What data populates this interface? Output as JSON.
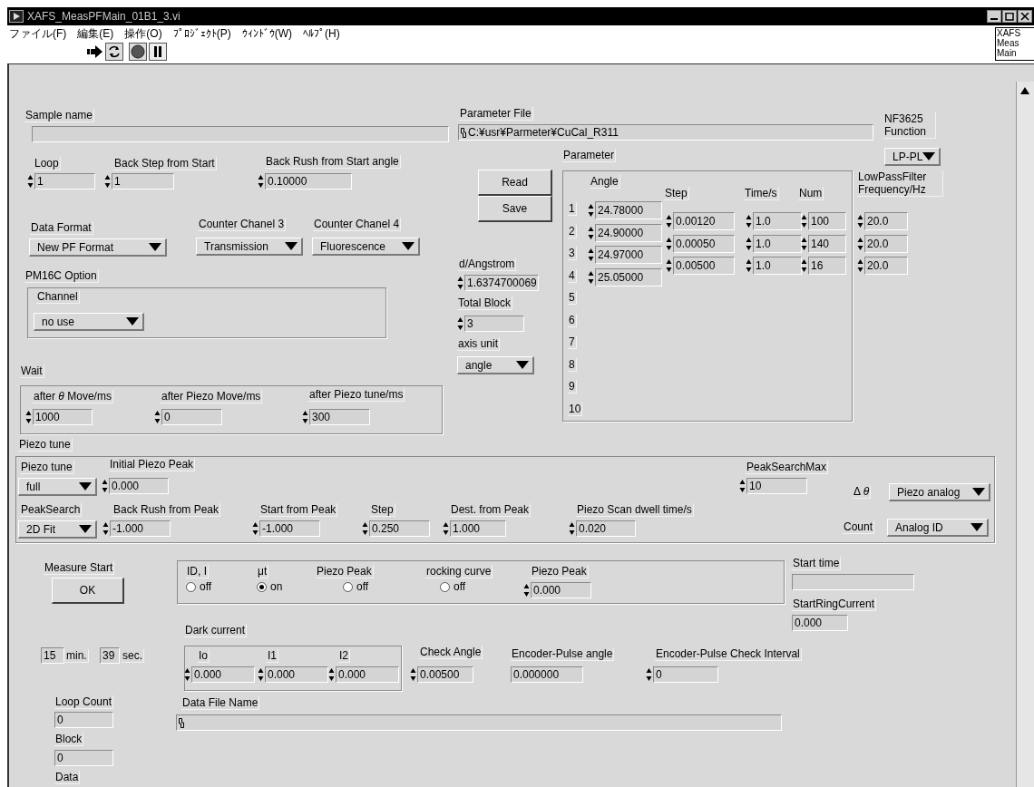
{
  "window": {
    "title": "XAFS_MeasPFMain_01B1_3.vi"
  },
  "menu": [
    "ファイル(F)",
    "編集(E)",
    "操作(O)",
    "ﾌﾟﾛｼﾞｪｸﾄ(P)",
    "ｳｨﾝﾄﾞｳ(W)",
    "ﾍﾙﾌﾟ(H)"
  ],
  "vi_icon": [
    "XAFS",
    "Meas",
    "Main"
  ],
  "items": [
    {
      "kind": "string",
      "label": "Sample name"
    },
    {
      "kind": "numeric",
      "label": "Loop",
      "value": "1"
    },
    {
      "kind": "numeric",
      "label": "Back Step from Start",
      "value": "1"
    },
    {
      "kind": "numeric",
      "label": "Back Rush from Start angle",
      "value": "0.10000"
    },
    {
      "kind": "path",
      "label": "Parameter File",
      "value": "C:¥usr¥Parmeter¥CuCal_R311"
    },
    {
      "kind": "ring",
      "label": "NF3625 Function",
      "value": "LP-PL"
    },
    {
      "kind": "button",
      "value": "Read"
    },
    {
      "kind": "button",
      "value": "Save"
    },
    {
      "kind": "ring",
      "label": "Data Format",
      "value": "New PF Format"
    },
    {
      "kind": "ring",
      "label": "Counter Chanel 3",
      "value": "Transmission"
    },
    {
      "kind": "ring",
      "label": "Counter Chanel 4",
      "value": "Fluorescence"
    },
    {
      "kind": "numeric",
      "label": "d/Angstrom",
      "value": "1.6374700069"
    },
    {
      "kind": "numeric",
      "label": "Total Block",
      "value": "3"
    },
    {
      "kind": "ring",
      "label": "axis unit",
      "value": "angle"
    },
    {
      "kind": "label",
      "label": "PM16C Option"
    },
    {
      "kind": "ring",
      "label": "Channel",
      "value": "no use"
    },
    {
      "kind": "label",
      "label": "Wait"
    },
    {
      "kind": "numeric",
      "label": "after *θ* Move/ms",
      "value": "1000"
    },
    {
      "kind": "numeric",
      "label": "after Piezo Move/ms",
      "value": "0"
    },
    {
      "kind": "numeric",
      "label": "after Piezo tune/ms",
      "value": "300"
    },
    {
      "kind": "label",
      "label": "Piezo tune"
    },
    {
      "kind": "ring",
      "label": "Piezo tune",
      "value": "full"
    },
    {
      "kind": "numeric",
      "label": "Initial Piezo Peak",
      "value": "0.000"
    },
    {
      "kind": "numeric",
      "label": "PeakSearchMax",
      "value": "10"
    },
    {
      "kind": "ring",
      "label": "Δ *θ*",
      "value": "Piezo analog"
    },
    {
      "kind": "ring",
      "label": "PeakSearch",
      "value": "2D Fit"
    },
    {
      "kind": "numeric",
      "label": "Back Rush from Peak",
      "value": "-1.000"
    },
    {
      "kind": "numeric",
      "label": "Start from Peak",
      "value": "-1.000"
    },
    {
      "kind": "numeric",
      "label": "Step",
      "value": "0.250"
    },
    {
      "kind": "numeric",
      "label": "Dest. from Peak",
      "value": "1.000"
    },
    {
      "kind": "numeric",
      "label": "Piezo Scan dwell time/s",
      "value": "0.020"
    },
    {
      "kind": "ring",
      "label": "Count",
      "value": "Analog ID"
    },
    {
      "kind": "button",
      "label": "Measure Start",
      "value": "OK"
    },
    {
      "kind": "radio",
      "label": "ID, I",
      "value": "off",
      "checked": false
    },
    {
      "kind": "radio",
      "label": "μt",
      "value": "on",
      "checked": true
    },
    {
      "kind": "radio",
      "label": "Piezo Peak",
      "value": "off",
      "checked": false
    },
    {
      "kind": "radio",
      "label": "rocking curve",
      "value": "off",
      "checked": false
    },
    {
      "kind": "numeric",
      "label": "Piezo Peak",
      "value": "0.000"
    },
    {
      "kind": "string",
      "label": "Start time"
    },
    {
      "kind": "indicator",
      "label": "StartRingCurrent",
      "value": "0.000"
    },
    {
      "kind": "label",
      "label": "Dark current"
    },
    {
      "kind": "indicator",
      "value": "15"
    },
    {
      "kind": "label",
      "label": "min."
    },
    {
      "kind": "indicator",
      "value": "39"
    },
    {
      "kind": "label",
      "label": "sec."
    },
    {
      "kind": "numeric",
      "label": "Io",
      "value": "0.000"
    },
    {
      "kind": "numeric",
      "label": "I1",
      "value": "0.000"
    },
    {
      "kind": "numeric",
      "label": "I2",
      "value": "0.000"
    },
    {
      "kind": "numeric",
      "label": "Check Angle",
      "value": "0.00500"
    },
    {
      "kind": "indicator",
      "label": "Encoder-Pulse angle",
      "value": "0.000000"
    },
    {
      "kind": "numeric",
      "label": "Encoder-Pulse Check Interval",
      "value": "0"
    },
    {
      "kind": "indicator",
      "label": "Loop Count",
      "value": "0"
    },
    {
      "kind": "indicator",
      "label": "Block",
      "value": "0"
    },
    {
      "kind": "label",
      "label": "Data"
    },
    {
      "kind": "path",
      "label": "Data File Name"
    }
  ],
  "parameter_table": {
    "label": "Parameter",
    "index": [
      "1",
      "2",
      "3",
      "4",
      "5",
      "6",
      "7",
      "8",
      "9",
      "10"
    ],
    "columns": [
      {
        "label": "Angle",
        "values": [
          "24.78000",
          "24.90000",
          "24.97000",
          "25.05000"
        ]
      },
      {
        "label": "Step",
        "values": [
          "0.00120",
          "0.00050",
          "0.00500"
        ]
      },
      {
        "label": "Time/s",
        "values": [
          "1.0",
          "1.0",
          "1.0"
        ]
      },
      {
        "label": "Num",
        "values": [
          "100",
          "140",
          "16"
        ]
      },
      {
        "label": "LowPassFilter Frequency/Hz",
        "values": [
          "20.0",
          "20.0",
          "20.0"
        ]
      }
    ]
  }
}
